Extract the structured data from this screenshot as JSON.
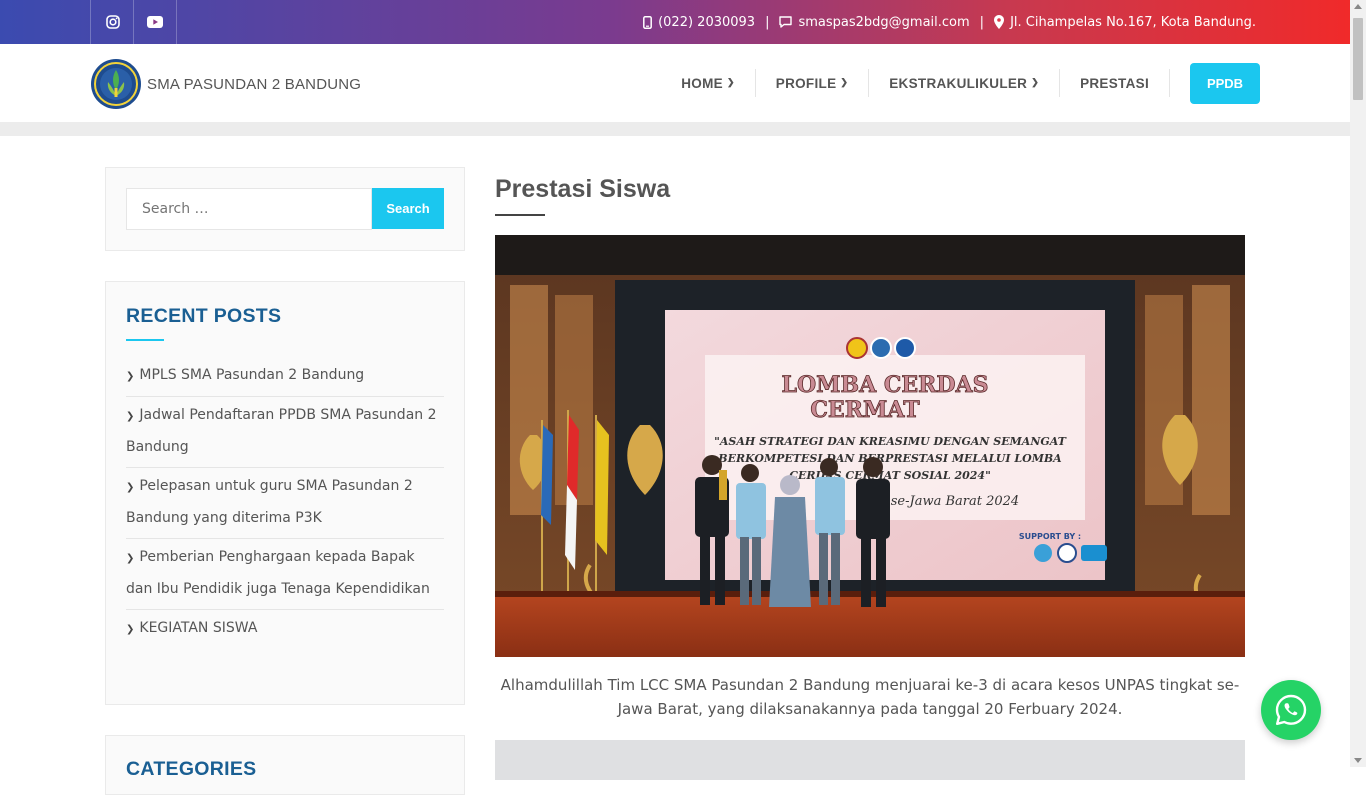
{
  "topbar": {
    "social": [
      {
        "icon": "instagram-icon"
      },
      {
        "icon": "youtube-icon"
      }
    ],
    "phone": "(022) 2030093",
    "email": "smaspas2bdg@gmail.com",
    "address": "Jl. Cihampelas No.167, Kota Bandung.",
    "separator": "|",
    "gradient": [
      "#3b4bb0",
      "#7a3b8f",
      "#c8394f",
      "#f02a2a"
    ]
  },
  "header": {
    "brand": "SMA PASUNDAN 2 BANDUNG",
    "menu": [
      {
        "label": "HOME",
        "has_dropdown": true
      },
      {
        "label": "PROFILE",
        "has_dropdown": true
      },
      {
        "label": "EKSTRAKULIKULER",
        "has_dropdown": true
      },
      {
        "label": "PRESTASI",
        "has_dropdown": false
      }
    ],
    "cta": "PPDB",
    "accent": "#1bc7ef"
  },
  "sidebar": {
    "search": {
      "placeholder": "Search …",
      "button": "Search"
    },
    "recent_title": "RECENT POSTS",
    "recent_posts": [
      "MPLS SMA Pasundan 2 Bandung",
      "Jadwal Pendaftaran PPDB SMA Pasundan 2 Bandung",
      "Pelepasan untuk guru SMA Pasundan 2 Bandung yang diterima P3K",
      "Pemberian Penghargaan kepada Bapak dan Ibu Pendidik juga Tenaga Kependidikan",
      "KEGIATAN SISWA"
    ],
    "categories_title": "CATEGORIES",
    "title_color": "#1a5f93"
  },
  "main": {
    "title": "Prestasi Siswa",
    "photo": {
      "screen_title_1": "LOMBA CERDAS",
      "screen_title_2": "CERMAT",
      "screen_line_1": "\"ASAH STRATEGI DAN KREASIMU DENGAN SEMANGAT",
      "screen_line_2": "BERKOMPETESI DAN BERPRESTASI MELALUI LOMBA",
      "screen_line_3": "CERDAS CERMAT SOSIAL 2024\"",
      "screen_line_4": "se-Jawa Barat 2024",
      "support": "SUPPORT BY :"
    },
    "caption": "Alhamdulillah Tim LCC SMA Pasundan 2 Bandung menjuarai ke-3 di acara kesos UNPAS tingkat se-Jawa Barat, yang dilaksanakannya pada tanggal 20 Ferbuary 2024."
  },
  "floating": {
    "icon": "whatsapp-icon",
    "color": "#25d366"
  }
}
